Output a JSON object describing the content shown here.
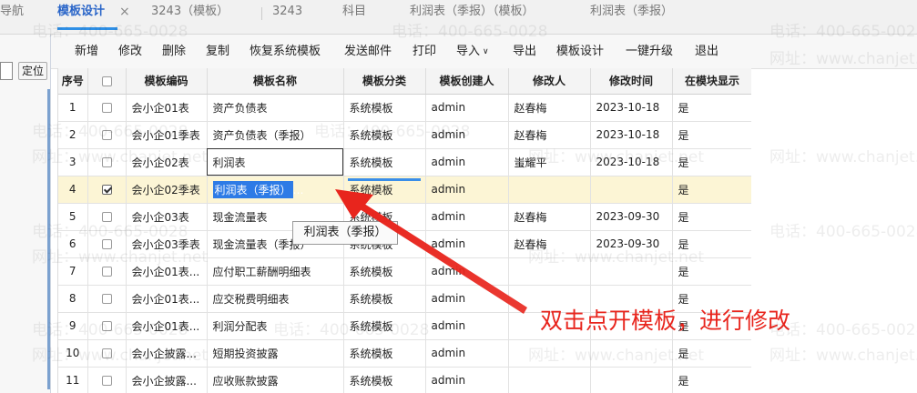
{
  "tabs": [
    {
      "label": "导航"
    },
    {
      "label": "模板设计",
      "close": "×"
    },
    {
      "label": "3243（模板）"
    },
    {
      "label": "3243"
    },
    {
      "label": "科目"
    },
    {
      "label": "利润表（季报）（模板）"
    },
    {
      "label": "利润表（季报）"
    }
  ],
  "left_nav": {
    "locate_button": "定位"
  },
  "toolbar": {
    "add": "新增",
    "edit": "修改",
    "delete": "删除",
    "copy": "复制",
    "restore": "恢复系统模板",
    "send_mail": "发送邮件",
    "print": "打印",
    "import": "导入",
    "export": "导出",
    "template_design": "模板设计",
    "upgrade": "一键升级",
    "exit": "退出"
  },
  "table": {
    "headers": [
      "序号",
      "",
      "模板编码",
      "模板名称",
      "模板分类",
      "模板创建人",
      "修改人",
      "修改时间",
      "在模块显示"
    ],
    "rows": [
      {
        "idx": "1",
        "checked": false,
        "code": "会小企01表",
        "name": "资产负债表",
        "category": "系统模板",
        "creator": "admin",
        "modifier": "赵春梅",
        "time": "2023-10-18",
        "show": "是"
      },
      {
        "idx": "2",
        "checked": false,
        "code": "会小企01季表",
        "name": "资产负债表（季报）",
        "category": "系统模板",
        "creator": "admin",
        "modifier": "赵春梅",
        "time": "2023-10-18",
        "show": "是"
      },
      {
        "idx": "3",
        "checked": false,
        "code": "会小企02表",
        "name": "利润表",
        "category": "系统模板",
        "creator": "admin",
        "modifier": "蚩耀平",
        "time": "2023-10-18",
        "show": "是"
      },
      {
        "idx": "4",
        "checked": true,
        "code": "会小企02季表",
        "name": "利润表（季报）",
        "category": "系统模板",
        "creator": "admin",
        "modifier": "",
        "time": "",
        "show": "是"
      },
      {
        "idx": "5",
        "checked": false,
        "code": "会小企03表",
        "name": "现金流量表",
        "category": "系统模板",
        "creator": "admin",
        "modifier": "赵春梅",
        "time": "2023-09-30",
        "show": "是"
      },
      {
        "idx": "6",
        "checked": false,
        "code": "会小企03季表",
        "name": "现金流量表（季报）",
        "category": "系统模板",
        "creator": "admin",
        "modifier": "赵春梅",
        "time": "2023-09-30",
        "show": "是"
      },
      {
        "idx": "7",
        "checked": false,
        "code": "会小企01表...",
        "name": "应付职工薪酬明细表",
        "category": "系统模板",
        "creator": "admin",
        "modifier": "",
        "time": "",
        "show": "是"
      },
      {
        "idx": "8",
        "checked": false,
        "code": "会小企01表...",
        "name": "应交税费明细表",
        "category": "系统模板",
        "creator": "admin",
        "modifier": "",
        "time": "",
        "show": "是"
      },
      {
        "idx": "9",
        "checked": false,
        "code": "会小企01表...",
        "name": "利润分配表",
        "category": "系统模板",
        "creator": "admin",
        "modifier": "",
        "time": "",
        "show": "是"
      },
      {
        "idx": "10",
        "checked": false,
        "code": "会小企披露...",
        "name": "短期投资披露",
        "category": "系统模板",
        "creator": "admin",
        "modifier": "",
        "time": "",
        "show": "是"
      },
      {
        "idx": "11",
        "checked": false,
        "code": "会小企披露...",
        "name": "应收账款披露",
        "category": "系统模板",
        "creator": "admin",
        "modifier": "",
        "time": "",
        "show": "是"
      }
    ]
  },
  "tooltip": "利润表（季报）",
  "annotation": "双击点开模板，进行修改",
  "colors": {
    "accent": "#2e7be6",
    "annotation": "#e8251d",
    "selected_row": "#fcf5d5"
  },
  "watermark": {
    "phone": "电话：400-665-0028",
    "site": "网址：www.chanjet.net"
  }
}
